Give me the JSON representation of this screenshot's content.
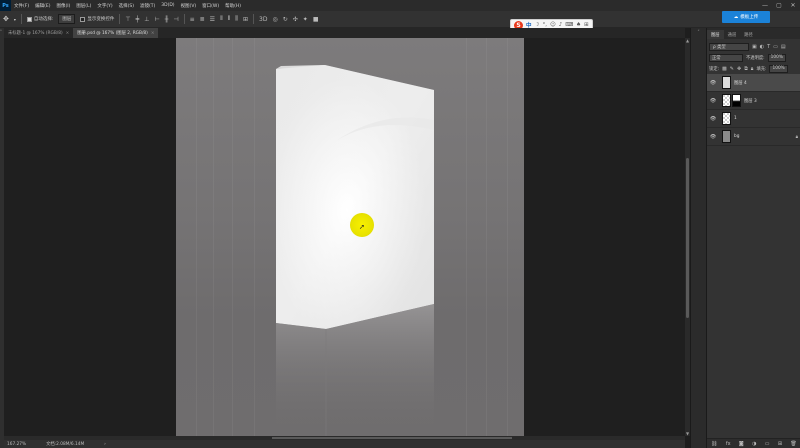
{
  "app": {
    "logo": "Ps"
  },
  "menu": [
    "文件(F)",
    "编辑(E)",
    "图像(I)",
    "图层(L)",
    "文字(Y)",
    "选择(S)",
    "滤镜(T)",
    "3D(D)",
    "视图(V)",
    "窗口(W)",
    "帮助(H)"
  ],
  "window_controls": [
    "—",
    "▢",
    "✕"
  ],
  "options": {
    "auto_select_label": "自动选择:",
    "auto_select_value": "图层",
    "show_transform_label": "显示变换控件"
  },
  "ime": {
    "logo": "S",
    "lang": "中"
  },
  "cloud_button": "模板上传",
  "tabs": [
    {
      "label": "未标题-1 @ 167% (RGB/8)",
      "close": "×"
    },
    {
      "label": "图册.psd @ 167% (图层 2, RGB/8)",
      "close": "×"
    }
  ],
  "status": {
    "zoom": "167.27%",
    "doc": "文档:2.08M/6.14M"
  },
  "layers_panel": {
    "tabs": [
      "图层",
      "通道",
      "路径"
    ],
    "kind_filter": "ρ 类型",
    "blend_mode": "正常",
    "opacity_label": "不透明度:",
    "opacity_value": "100%",
    "lock_label": "锁定:",
    "fill_label": "填充:",
    "fill_value": "100%",
    "layers": [
      {
        "name": "图层 4",
        "selected": true,
        "thumb": "white"
      },
      {
        "name": "图层 3",
        "selected": false,
        "thumb": "checker",
        "mask": true
      },
      {
        "name": "1",
        "selected": false,
        "thumb": "checker"
      },
      {
        "name": "bg",
        "selected": false,
        "thumb": "gray",
        "locked": true
      }
    ]
  }
}
